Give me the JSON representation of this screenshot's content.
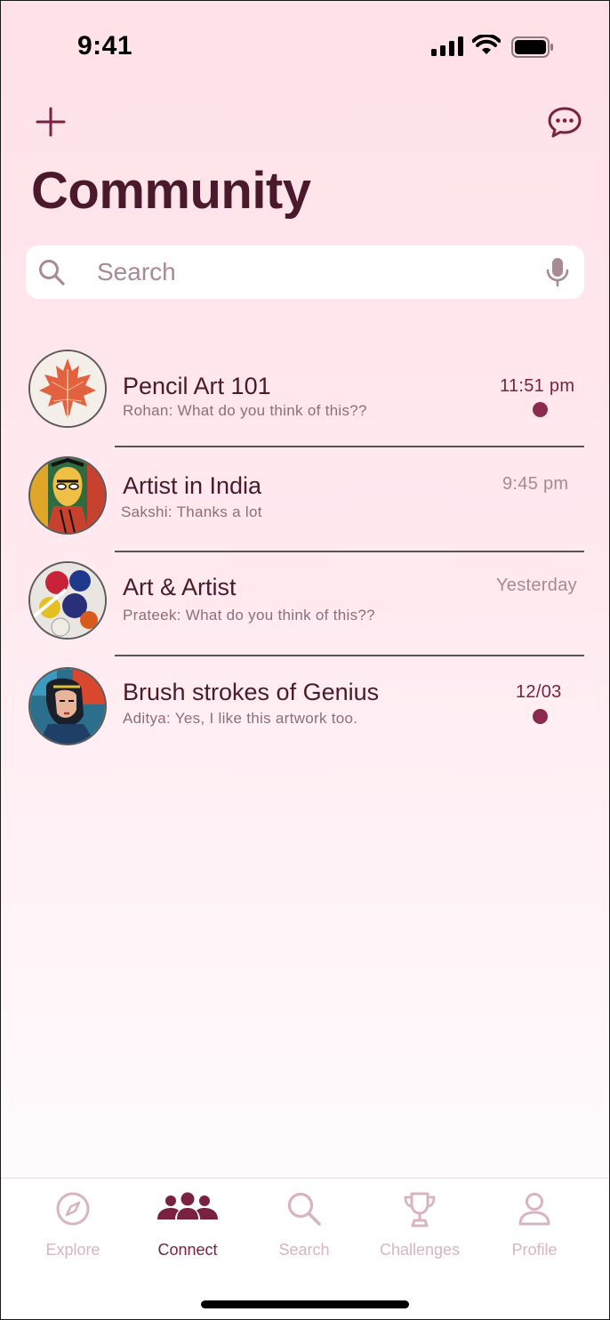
{
  "status_bar": {
    "time": "9:41"
  },
  "header": {
    "title": "Community",
    "add_icon": "plus-icon",
    "messages_icon": "chat-bubble-icon"
  },
  "search": {
    "placeholder": "Search",
    "value": ""
  },
  "chats": [
    {
      "name": "Pencil Art 101",
      "message": "Rohan: What do you think of this??",
      "time": "11:51 pm",
      "unread": true,
      "avatar": "maple-leaf-artwork"
    },
    {
      "name": "Artist in India",
      "message": "Sakshi: Thanks a lot",
      "time": "9:45 pm",
      "unread": false,
      "avatar": "indian-folk-painting"
    },
    {
      "name": "Art & Artist",
      "message": "Prateek: What do you think of this??",
      "time": "Yesterday",
      "unread": false,
      "avatar": "paint-palette"
    },
    {
      "name": "Brush strokes of Genius",
      "message": "Aditya: Yes, I like this artwork too.",
      "time": "12/03",
      "unread": true,
      "avatar": "portrait-painting"
    }
  ],
  "tabs": [
    {
      "label": "Explore",
      "icon": "compass-icon",
      "active": false
    },
    {
      "label": "Connect",
      "icon": "people-icon",
      "active": true
    },
    {
      "label": "Search",
      "icon": "search-icon",
      "active": false
    },
    {
      "label": "Challenges",
      "icon": "trophy-icon",
      "active": false
    },
    {
      "label": "Profile",
      "icon": "person-icon",
      "active": false
    }
  ],
  "colors": {
    "accent": "#7a2142",
    "title": "#4a1a2c",
    "unread_dot": "#8b2a4d",
    "inactive_tab": "#d8b4c0",
    "background_top": "#ffe1e8"
  }
}
